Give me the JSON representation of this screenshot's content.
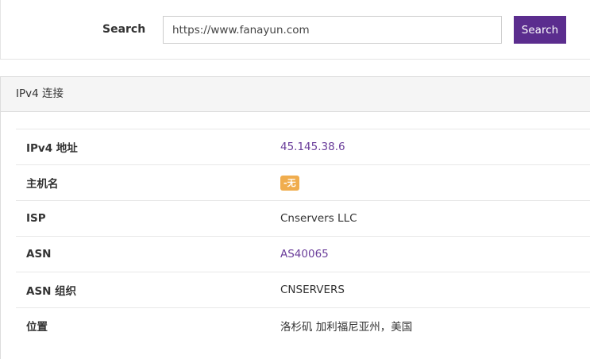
{
  "search": {
    "label": "Search",
    "value": "https://www.fanayun.com",
    "button_label": "Search"
  },
  "panel": {
    "title": "IPv4 连接"
  },
  "rows": {
    "ip": {
      "key": "IPv4 地址",
      "value": "45.145.38.6"
    },
    "hostname": {
      "key": "主机名",
      "value": "-无"
    },
    "isp": {
      "key": "ISP",
      "value": "Cnservers LLC"
    },
    "asn": {
      "key": "ASN",
      "value": "AS40065"
    },
    "asn_org": {
      "key": "ASN 组织",
      "value": "CNSERVERS"
    },
    "location": {
      "key": "位置",
      "value": "洛杉矶 加利福尼亚州，美国"
    }
  },
  "colors": {
    "button": "#5b2d8e",
    "link": "#6a3d9a",
    "badge": "#f0ad4e"
  }
}
